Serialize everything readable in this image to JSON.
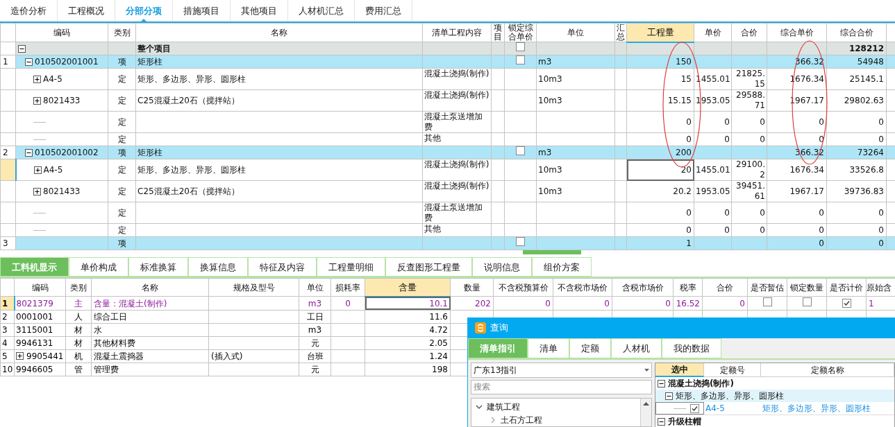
{
  "top_tabs": [
    {
      "label": "造价分析",
      "selected": false
    },
    {
      "label": "工程概况",
      "selected": false
    },
    {
      "label": "分部分项",
      "selected": true
    },
    {
      "label": "措施项目",
      "selected": false
    },
    {
      "label": "其他项目",
      "selected": false
    },
    {
      "label": "人材机汇总",
      "selected": false
    },
    {
      "label": "费用汇总",
      "selected": false
    }
  ],
  "items_table": {
    "columns": [
      {
        "label": "编码",
        "selected": false
      },
      {
        "label": "类别",
        "selected": false
      },
      {
        "label": "名称",
        "selected": false
      },
      {
        "label": "清单工程内容",
        "selected": false
      },
      {
        "label": "项目",
        "selected": false
      },
      {
        "label": "锁定综合单价",
        "selected": false
      },
      {
        "label": "单位",
        "selected": false
      },
      {
        "label": "汇总",
        "selected": false
      },
      {
        "label": "工程量",
        "selected": true
      },
      {
        "label": "单价",
        "selected": false
      },
      {
        "label": "合价",
        "selected": false
      },
      {
        "label": "综合单价",
        "selected": false
      },
      {
        "label": "综合合价",
        "selected": false
      }
    ],
    "rows": [
      {
        "kind": "root",
        "selected": false,
        "expanded": true,
        "name": "整个项目",
        "locked": false,
        "composite_total": "128212"
      },
      {
        "kind": "item",
        "selected": false,
        "number": "1",
        "expanded": true,
        "code": "010502001001",
        "type": "项",
        "name": "矩形柱",
        "locked": false,
        "unit": "m3",
        "quantity": "150",
        "composite_unit_price": "366.32",
        "composite_total": "54948"
      },
      {
        "kind": "quota",
        "selected": false,
        "expanded": false,
        "code": "A4-5",
        "type": "定",
        "name": "矩形、多边形、异形、圆形柱",
        "content": "混凝土浇捣(制作)",
        "unit": "10m3",
        "quantity": "15",
        "unit_price": "1455.01",
        "total_price": "21825.15",
        "composite_unit_price": "1676.34",
        "composite_total": "25145.1"
      },
      {
        "kind": "quota",
        "selected": false,
        "expanded": false,
        "code": "8021433",
        "type": "定",
        "name": "C25混凝土20石（搅拌站）",
        "content": "混凝土浇捣(制作)",
        "unit": "10m3",
        "quantity": "15.15",
        "unit_price": "1953.05",
        "total_price": "29588.71",
        "composite_unit_price": "1967.17",
        "composite_total": "29802.63"
      },
      {
        "kind": "sub",
        "selected": false,
        "type": "定",
        "content": "混凝土泵送增加费",
        "quantity": "0",
        "unit_price": "0",
        "total_price": "0",
        "composite_unit_price": "0",
        "composite_total": "0"
      },
      {
        "kind": "sub",
        "selected": false,
        "type": "定",
        "content": "其他",
        "quantity": "0",
        "unit_price": "0",
        "total_price": "0",
        "composite_unit_price": "0",
        "composite_total": "0"
      },
      {
        "kind": "item",
        "selected": false,
        "number": "2",
        "expanded": true,
        "code": "010502001002",
        "type": "项",
        "name": "矩形柱",
        "locked": false,
        "unit": "m3",
        "quantity": "200",
        "composite_unit_price": "366.32",
        "composite_total": "73264"
      },
      {
        "kind": "quota",
        "selected": true,
        "expanded": false,
        "code": "A4-5",
        "type": "定",
        "name": "矩形、多边形、异形、圆形柱",
        "content": "混凝土浇捣(制作)",
        "unit": "10m3",
        "quantity": "20",
        "unit_price": "1455.01",
        "total_price": "29100.2",
        "composite_unit_price": "1676.34",
        "composite_total": "33526.8"
      },
      {
        "kind": "quota",
        "selected": false,
        "expanded": false,
        "code": "8021433",
        "type": "定",
        "name": "C25混凝土20石（搅拌站）",
        "content": "混凝土浇捣(制作)",
        "unit": "10m3",
        "quantity": "20.2",
        "unit_price": "1953.05",
        "total_price": "39451.61",
        "composite_unit_price": "1967.17",
        "composite_total": "39736.83"
      },
      {
        "kind": "sub",
        "selected": false,
        "type": "定",
        "content": "混凝土泵送增加费",
        "quantity": "0",
        "unit_price": "0",
        "total_price": "0",
        "composite_unit_price": "0",
        "composite_total": "0"
      },
      {
        "kind": "sub",
        "selected": false,
        "type": "定",
        "content": "其他",
        "quantity": "0",
        "unit_price": "0",
        "total_price": "0",
        "composite_unit_price": "0",
        "composite_total": "0"
      },
      {
        "kind": "item",
        "selected": false,
        "number": "3",
        "type": "项",
        "locked": false,
        "quantity": "1",
        "composite_unit_price": "0",
        "composite_total": "0"
      }
    ]
  },
  "detail_tabs": [
    {
      "label": "工料机显示",
      "selected": true
    },
    {
      "label": "单价构成",
      "selected": false
    },
    {
      "label": "标准换算",
      "selected": false
    },
    {
      "label": "换算信息",
      "selected": false
    },
    {
      "label": "特征及内容",
      "selected": false
    },
    {
      "label": "工程量明细",
      "selected": false
    },
    {
      "label": "反查图形工程量",
      "selected": false
    },
    {
      "label": "说明信息",
      "selected": false
    },
    {
      "label": "组价方案",
      "selected": false
    }
  ],
  "resources_table": {
    "columns": [
      {
        "label": "编码",
        "selected": false
      },
      {
        "label": "类别",
        "selected": false
      },
      {
        "label": "名称",
        "selected": false
      },
      {
        "label": "规格及型号",
        "selected": false
      },
      {
        "label": "单位",
        "selected": false
      },
      {
        "label": "损耗率",
        "selected": false
      },
      {
        "label": "含量",
        "selected": true
      },
      {
        "label": "数量",
        "selected": false
      },
      {
        "label": "不含税预算价",
        "selected": false
      },
      {
        "label": "不含税市场价",
        "selected": false
      },
      {
        "label": "含税市场价",
        "selected": false
      },
      {
        "label": "税率",
        "selected": false
      },
      {
        "label": "合价",
        "selected": false
      },
      {
        "label": "是否暂估",
        "selected": false
      },
      {
        "label": "锁定数量",
        "selected": false
      },
      {
        "label": "是否计价",
        "selected": false
      },
      {
        "label": "原始含",
        "selected": false
      }
    ],
    "rows": [
      {
        "number": "1",
        "selected": true,
        "code": "8021379",
        "type": "主",
        "name": "含量：混凝土(制作)",
        "unit": "m3",
        "loss_rate": "0",
        "content": "10.1",
        "quantity": "202",
        "budget_price": "0",
        "market_price": "0",
        "tax_market_price": "0",
        "tax_rate": "16.52",
        "total": "0",
        "estimated": false,
        "lock_quantity": false,
        "priced": true,
        "original": "1"
      },
      {
        "number": "2",
        "selected": false,
        "code": "0001001",
        "type": "人",
        "name": "综合工日",
        "unit": "工日",
        "content": "11.6"
      },
      {
        "number": "3",
        "selected": false,
        "code": "3115001",
        "type": "材",
        "name": "水",
        "unit": "m3",
        "content": "4.72"
      },
      {
        "number": "4",
        "selected": false,
        "code": "9946131",
        "type": "材",
        "name": "其他材料费",
        "unit": "元",
        "content": "2.05"
      },
      {
        "number": "5",
        "selected": false,
        "expanded": false,
        "code": "9905441",
        "type": "机",
        "name": "混凝土震捣器",
        "spec": "(插入式)",
        "unit": "台班",
        "content": "1.24"
      },
      {
        "number": "10",
        "selected": false,
        "code": "9946605",
        "type": "管",
        "name": "管理费",
        "unit": "元",
        "content": "198"
      }
    ]
  },
  "query_dialog": {
    "title": "查询",
    "tabs": [
      {
        "label": "清单指引",
        "selected": true
      },
      {
        "label": "清单",
        "selected": false
      },
      {
        "label": "定额",
        "selected": false
      },
      {
        "label": "人材机",
        "selected": false
      },
      {
        "label": "我的数据",
        "selected": false
      }
    ],
    "guide_select": "广东13指引",
    "search": {
      "placeholder": "搜索"
    },
    "tree": [
      {
        "label": "建筑工程",
        "expanded": true,
        "children": [
          {
            "label": "土石方工程",
            "expanded": false
          }
        ]
      }
    ],
    "quota_table": {
      "columns": [
        {
          "label": "选中",
          "selected": true
        },
        {
          "label": "定额号",
          "selected": false
        },
        {
          "label": "定额名称",
          "selected": false
        }
      ],
      "rows": [
        {
          "kind": "group",
          "expanded": true,
          "label": "混凝土浇捣(制作)"
        },
        {
          "kind": "subgroup",
          "expanded": true,
          "label": "矩形、多边形、异形、圆形柱"
        },
        {
          "kind": "entry",
          "checked": true,
          "code": "A4-5",
          "name": "矩形、多边形、异形、圆形柱"
        },
        {
          "kind": "group",
          "expanded": true,
          "label": "升级柱帽"
        }
      ]
    }
  }
}
